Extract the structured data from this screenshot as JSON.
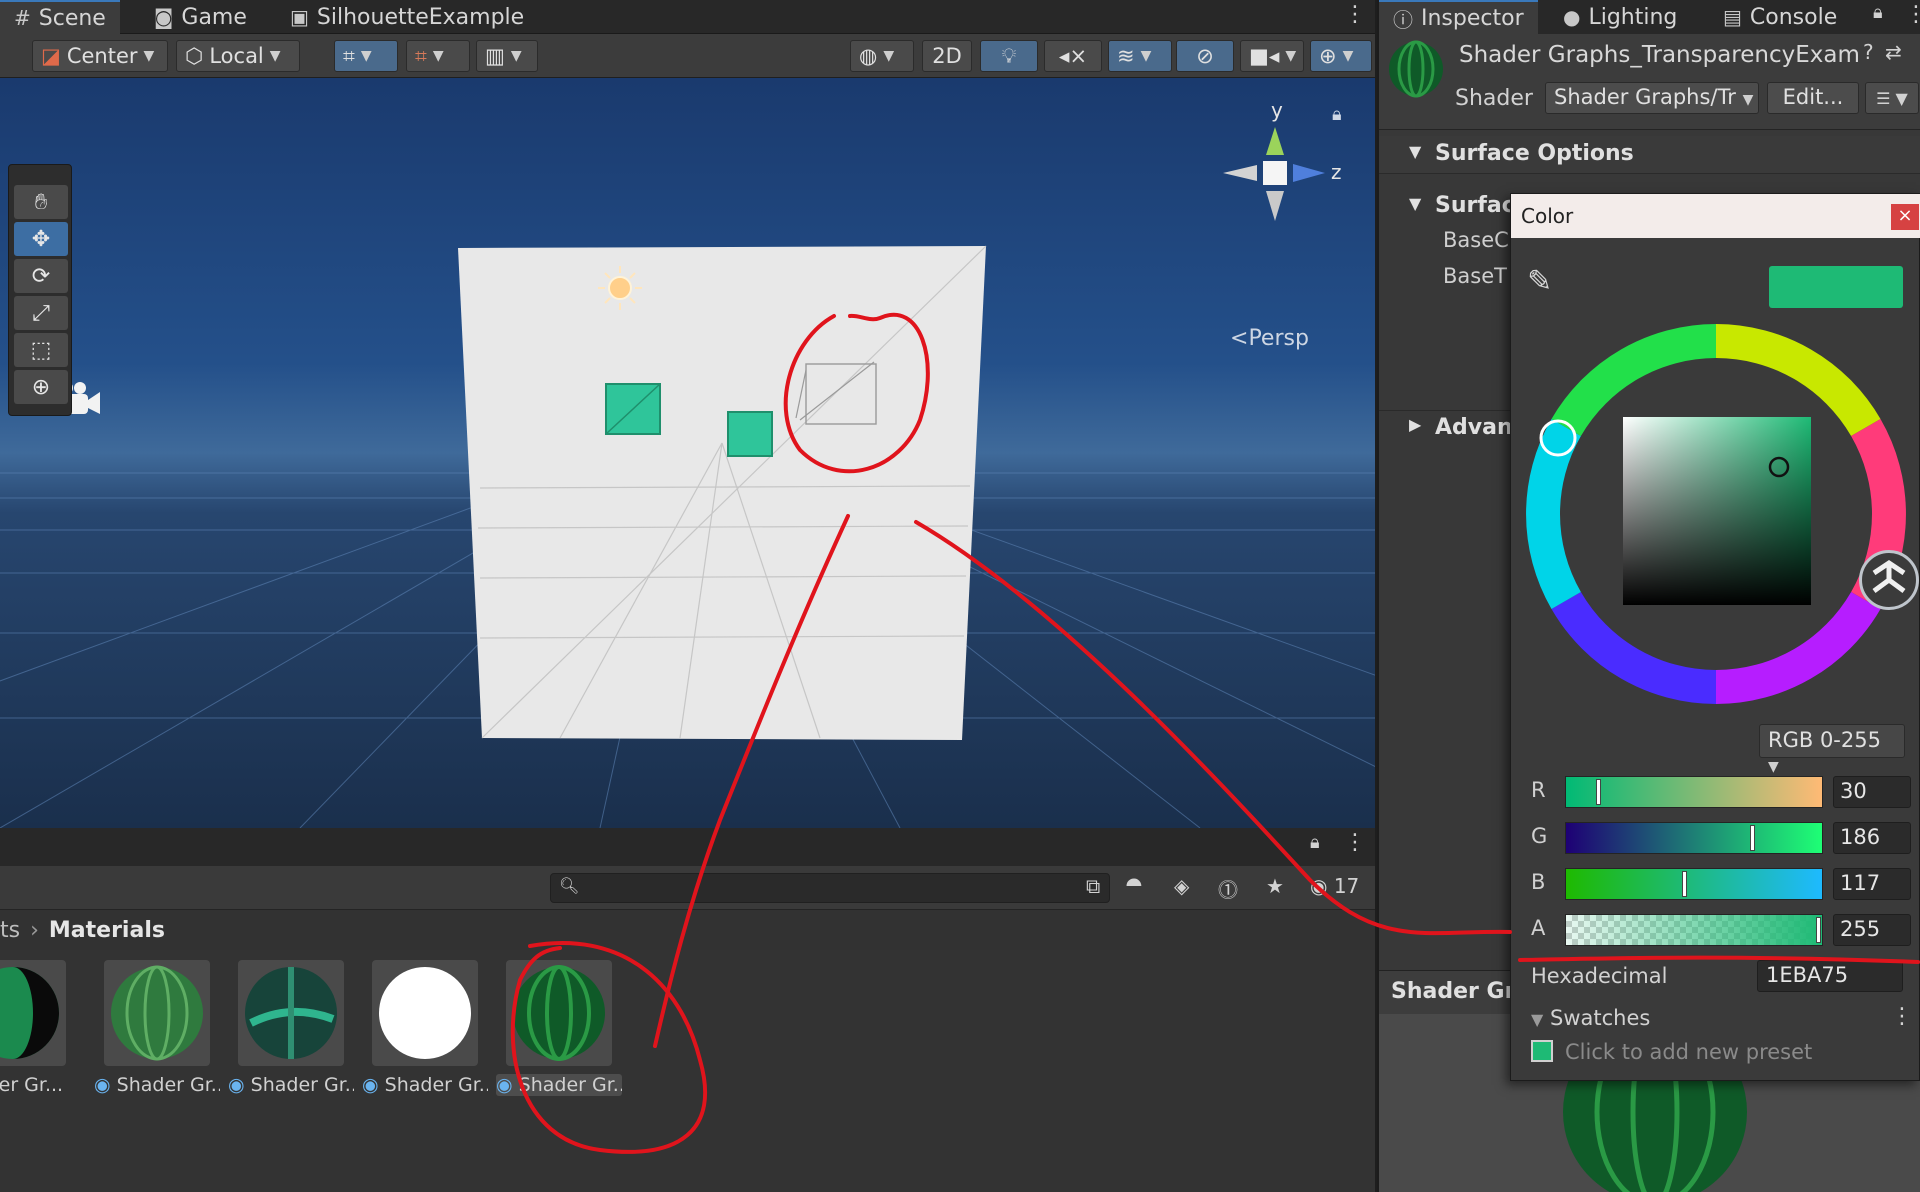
{
  "scene_tabs": [
    {
      "label": "Scene",
      "icon": "grid-icon"
    },
    {
      "label": "Game",
      "icon": "gamepad-icon"
    },
    {
      "label": "SilhouetteExample",
      "icon": "scene-object-icon"
    }
  ],
  "scene_toolbar": {
    "pivot_label": "Center",
    "space_label": "Local",
    "mode_2d_label": "2D"
  },
  "viewport": {
    "persp_label": "Persp",
    "gizmo_y": "y",
    "gizmo_z": "z"
  },
  "inspector_tabs": [
    {
      "label": "Inspector",
      "icon": "info-icon"
    },
    {
      "label": "Lighting",
      "icon": "bulb-icon"
    },
    {
      "label": "Console",
      "icon": "console-icon"
    }
  ],
  "inspector": {
    "material_title": "Shader Graphs_TransparencyExam",
    "shader_label": "Shader",
    "shader_value": "Shader Graphs/Tr",
    "edit_label": "Edit...",
    "surface_options": "Surface Options",
    "surface_inputs": "Surfac",
    "base_map_1": "BaseC",
    "base_map_2": "BaseT",
    "advanced": "Advanc",
    "preview_title": "Shader Gra"
  },
  "project": {
    "search_placeholder": "",
    "count_label": "17",
    "breadcrumb_prefix": "ts",
    "breadcrumb_folder": "Materials",
    "assets": [
      {
        "label": "hader Gr..."
      },
      {
        "label": "Shader Gr..."
      },
      {
        "label": "Shader Gr..."
      },
      {
        "label": "Shader Gr..."
      },
      {
        "label": "Shader Gr..."
      }
    ]
  },
  "color_picker": {
    "title": "Color",
    "close": "×",
    "mode": "RGB 0-255",
    "channels": [
      {
        "letter": "R",
        "value": "30",
        "fraction": 0.118
      },
      {
        "letter": "G",
        "value": "186",
        "fraction": 0.729
      },
      {
        "letter": "B",
        "value": "117",
        "fraction": 0.459
      },
      {
        "letter": "A",
        "value": "255",
        "fraction": 1.0
      }
    ],
    "hex_label": "Hexadecimal",
    "hex_value": "1EBA75",
    "swatches_label": "Swatches",
    "preset_hint": "Click to add new preset",
    "current_color": "#1eba75"
  },
  "colors": {
    "accent": "#3a79bb",
    "annotation": "#e0141c",
    "material_green": "#1eba75"
  }
}
